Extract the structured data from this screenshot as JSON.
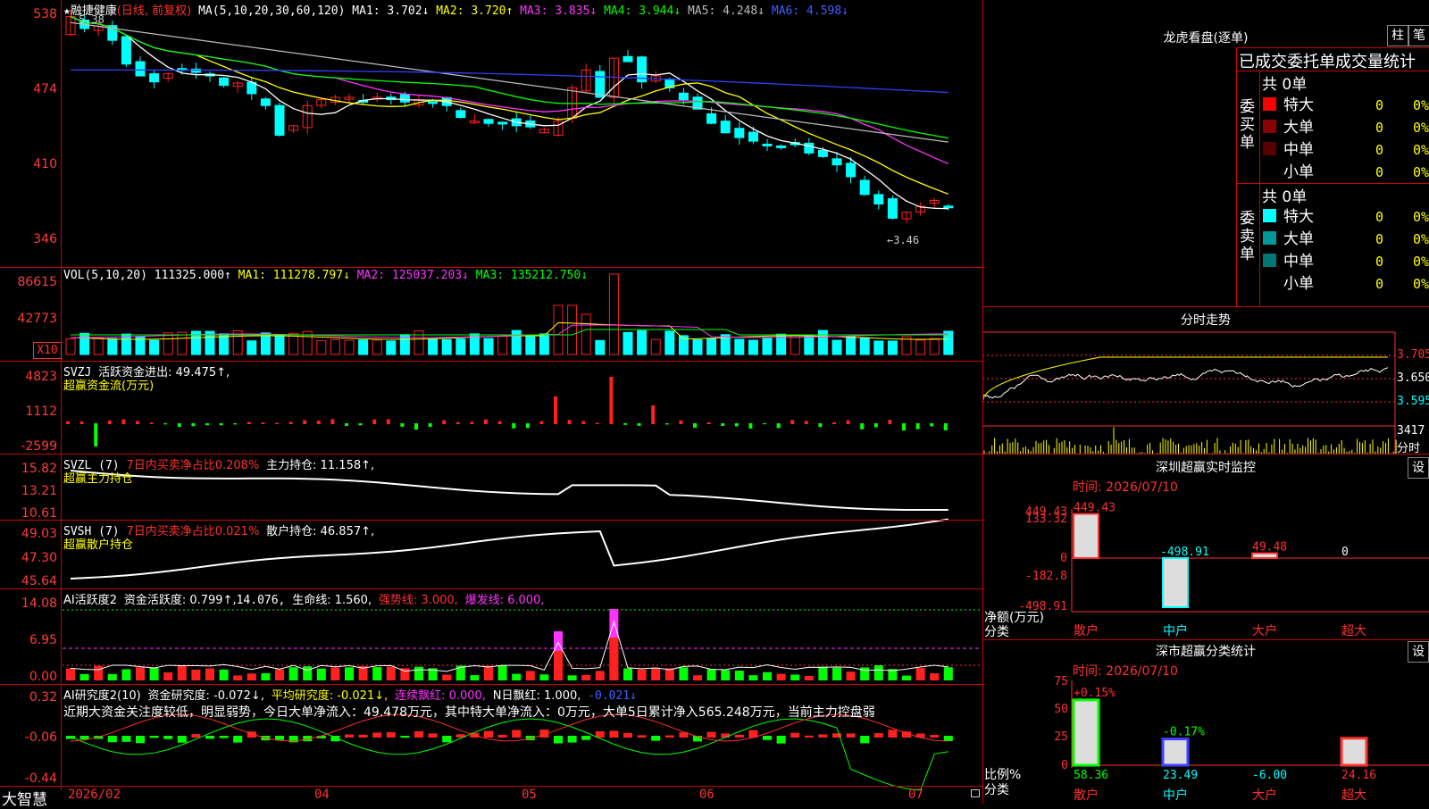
{
  "main_chart": {
    "star": "★",
    "stock_name": "融捷健康",
    "period": "(日线, 前复权)",
    "ma_params": "MA(5,10,20,30,60,120)",
    "ma1": "MA1: 3.702↓",
    "ma2": "MA2: 3.720↑",
    "ma3": "MA3: 3.835↓",
    "ma4": "MA4: 3.944↓",
    "ma5": "MA5: 4.248↓",
    "ma6": "MA6: 4.598↓",
    "y_ticks": [
      "538",
      "474",
      "410",
      "346"
    ],
    "high_marker": "5.38",
    "low_marker": "←3.46",
    "colors": {
      "ma1": "#ffffff",
      "ma2": "#ffff00",
      "ma3": "#ff33ff",
      "ma4": "#00ff00",
      "ma5": "#bbbbbb",
      "ma6": "#3040ff",
      "up": "#ff2020",
      "down": "#00ffff"
    }
  },
  "vol_panel": {
    "title": "VOL(5,10,20)",
    "vol": "111325.000↑",
    "ma1": "MA1: 111278.797↓",
    "ma2": "MA2: 125037.203↓",
    "ma3": "MA3: 135212.750↓",
    "y_ticks": [
      "86615",
      "42773"
    ],
    "unit_label": "X10"
  },
  "svzj_panel": {
    "title": "SVZJ",
    "metric": "活跃资金进出: 49.475↑,",
    "sub": "超赢资金流(万元)",
    "y_ticks": [
      "4823",
      "1112",
      "-2599"
    ]
  },
  "svzl_panel": {
    "title": "SVZL (7)",
    "ratio": "7日内买卖净占比0.208%",
    "holding": "主力持仓: 11.158↑,",
    "sub": "超赢主力持仓",
    "y_ticks": [
      "15.82",
      "13.21",
      "10.61"
    ]
  },
  "svsh_panel": {
    "title": "SVSH (7)",
    "ratio": "7日内买卖净占比0.021%",
    "holding": "散户持仓: 46.857↑,",
    "sub": "超赢散户持仓",
    "y_ticks": [
      "49.03",
      "47.30",
      "45.64"
    ]
  },
  "ai_active_panel": {
    "title": "AI活跃度2",
    "active": "资金活跃度: 0.799↑,",
    "v2": "14.076,",
    "life": "生命线: 1.560,",
    "strong": "强势线: 3.000,",
    "burst": "爆发线: 6.000,",
    "y_ticks": [
      "14.08",
      "6.95",
      "0.00"
    ]
  },
  "ai_research_panel": {
    "title": "AI研究度2(10)",
    "research": "资金研究度: -0.072↓,",
    "avg": "平均研究度: -0.021↓,",
    "streak": "连续飘红: 0.000,",
    "nday": "N日飘红: 1.000,",
    "last": "-0.021↓",
    "comment": "近期大资金关注度较低，明显弱势，今日大单净流入：49.478万元，其中特大单净流入：0万元，大单5日累计净入565.248万元，当前主力控盘弱",
    "y_ticks": [
      "0.32",
      "-0.06",
      "-0.44"
    ]
  },
  "x_axis": {
    "logo": "大智慧",
    "labels": [
      "2026/02",
      "04",
      "05",
      "06",
      "07"
    ]
  },
  "right_panel": {
    "longhu": {
      "title": "龙虎看盘(逐单)",
      "btn_bar": "柱",
      "btn_pen": "笔",
      "header": "已成交委托单成交量统计",
      "buy": {
        "side": [
          "委",
          "买",
          "单"
        ],
        "total": "共 0单",
        "rows": [
          {
            "label": "特大",
            "color": "#ff0000",
            "vol": "0",
            "pct": "0%"
          },
          {
            "label": "大单",
            "color": "#8b0000",
            "vol": "0",
            "pct": "0%"
          },
          {
            "label": "中单",
            "color": "#5a0000",
            "vol": "0",
            "pct": "0%"
          },
          {
            "label": "小单",
            "color": "",
            "vol": "0",
            "pct": "0%"
          }
        ]
      },
      "sell": {
        "side": [
          "委",
          "卖",
          "单"
        ],
        "total": "共 0单",
        "rows": [
          {
            "label": "特大",
            "color": "#00ffff",
            "vol": "0",
            "pct": "0%"
          },
          {
            "label": "大单",
            "color": "#009999",
            "vol": "0",
            "pct": "0%"
          },
          {
            "label": "中单",
            "color": "#007777",
            "vol": "0",
            "pct": "0%"
          },
          {
            "label": "小单",
            "color": "",
            "vol": "0",
            "pct": "0%"
          }
        ]
      }
    },
    "intraday": {
      "title": "分时走势",
      "y_ticks": [
        "3.705",
        "3.650",
        "3.595"
      ],
      "vol_label": "3417",
      "vol_unit": "分时"
    },
    "sz_monitor": {
      "title": "深圳超赢实时监控",
      "settings": "设",
      "time": "时间: 2026/07/10",
      "y_ticks": [
        "449.43",
        "133.32",
        "0",
        "-182.8",
        "-498.91"
      ],
      "ylabel": "净额(万元)",
      "xlabel": "分类",
      "bars": [
        {
          "name": "散户",
          "value": 449.43,
          "label": "449.43"
        },
        {
          "name": "中户",
          "value": -498.91,
          "label": "-498.91"
        },
        {
          "name": "大户",
          "value": 49.48,
          "label": "49.48"
        },
        {
          "name": "超大",
          "value": 0,
          "label": "0"
        }
      ]
    },
    "sz_class": {
      "title": "深市超赢分类统计",
      "settings": "设",
      "time": "时间: 2026/07/10",
      "y_ticks": [
        "75",
        "50",
        "25",
        "0"
      ],
      "ylabel": "比例%",
      "xlabel": "分类",
      "bars": [
        {
          "name": "散户",
          "value": 58.36,
          "label": "58.36",
          "change": "+0.15%"
        },
        {
          "name": "中户",
          "value": 23.49,
          "label": "23.49",
          "change": "-0.17%"
        },
        {
          "name": "大户",
          "value": -6.0,
          "label": "-6.00",
          "change": ""
        },
        {
          "name": "超大",
          "value": 24.16,
          "label": "24.16",
          "change": ""
        }
      ]
    }
  }
}
